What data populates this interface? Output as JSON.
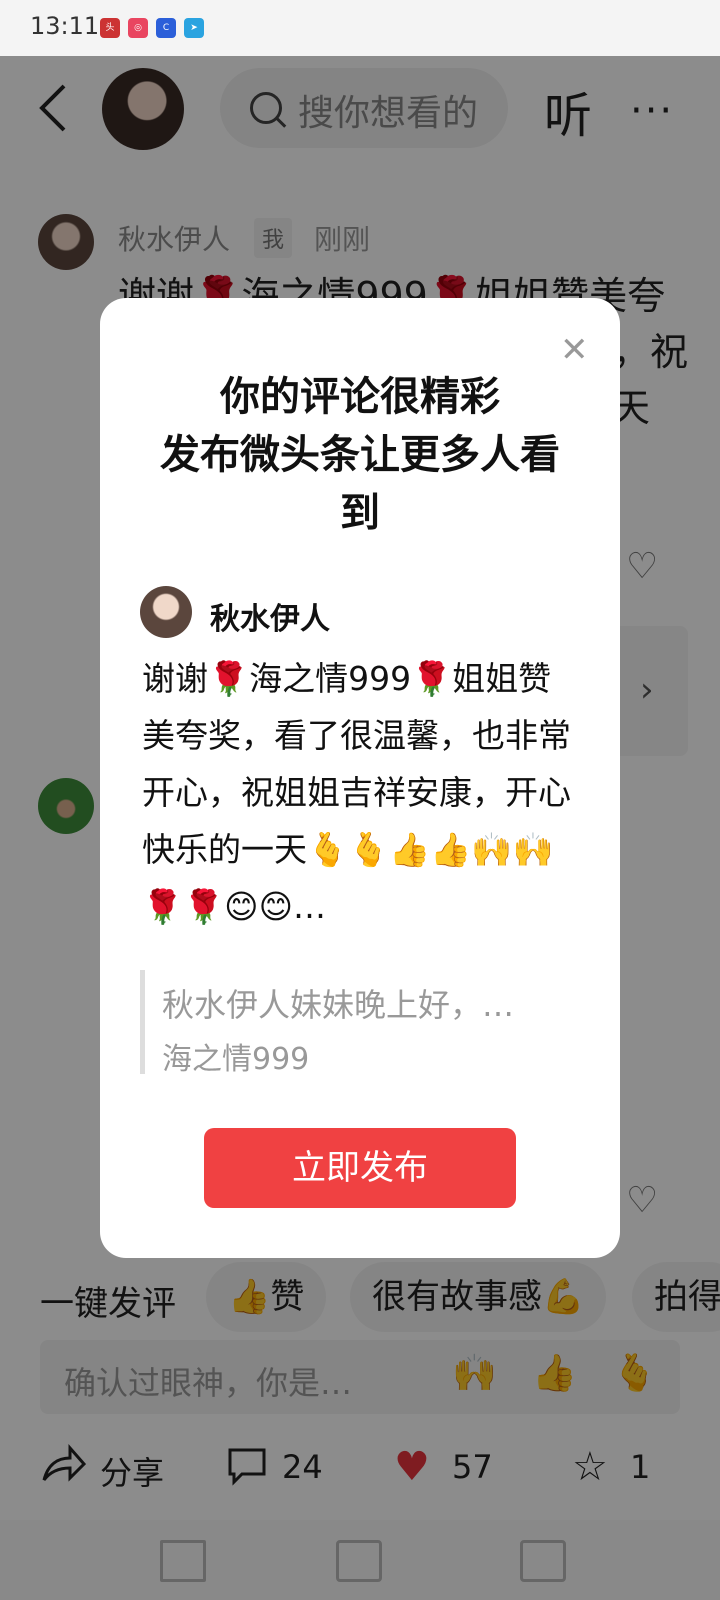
{
  "status_bar": {
    "time": "13:11",
    "icons": [
      "toutiao-icon",
      "app-icon",
      "browser-icon",
      "telegram-icon"
    ]
  },
  "header": {
    "search_placeholder": "搜你想看的",
    "listen_label": "听",
    "more_label": "···"
  },
  "feed": {
    "comment1": {
      "author": "秋水伊人",
      "me_badge": "我",
      "time": "刚刚",
      "body": "谢谢🌹海之情999🌹姐姐赞美夸奖，看了很温馨，也非常开心，祝姐姐吉祥安康，开心快乐的一天🫰🫰"
    }
  },
  "quick_reply": {
    "label": "一键发评",
    "chips": [
      "👍赞",
      "很有故事感💪",
      "拍得"
    ],
    "input_placeholder": "确认过眼神，你是…",
    "emojis": [
      "🙌",
      "👍",
      "🫰"
    ]
  },
  "actions": {
    "share": "分享",
    "comments": "24",
    "likes": "57",
    "stars": "1"
  },
  "modal": {
    "title_line1": "你的评论很精彩",
    "title_line2": "发布微头条让更多人看",
    "title_line3": "到",
    "author": "秋水伊人",
    "body": "谢谢🌹海之情999🌹姐姐赞美夸奖，看了很温馨，也非常开心，祝姐姐吉祥安康，开心快乐的一天🫰🫰👍👍🙌🙌🌹🌹😊😊…",
    "quote_text": "秋水伊人妹妹晚上好，…",
    "quote_author": "海之情999",
    "publish_label": "立即发布"
  },
  "colors": {
    "primary": "#f04142",
    "overlay": "rgba(0,0,0,0.45)"
  }
}
